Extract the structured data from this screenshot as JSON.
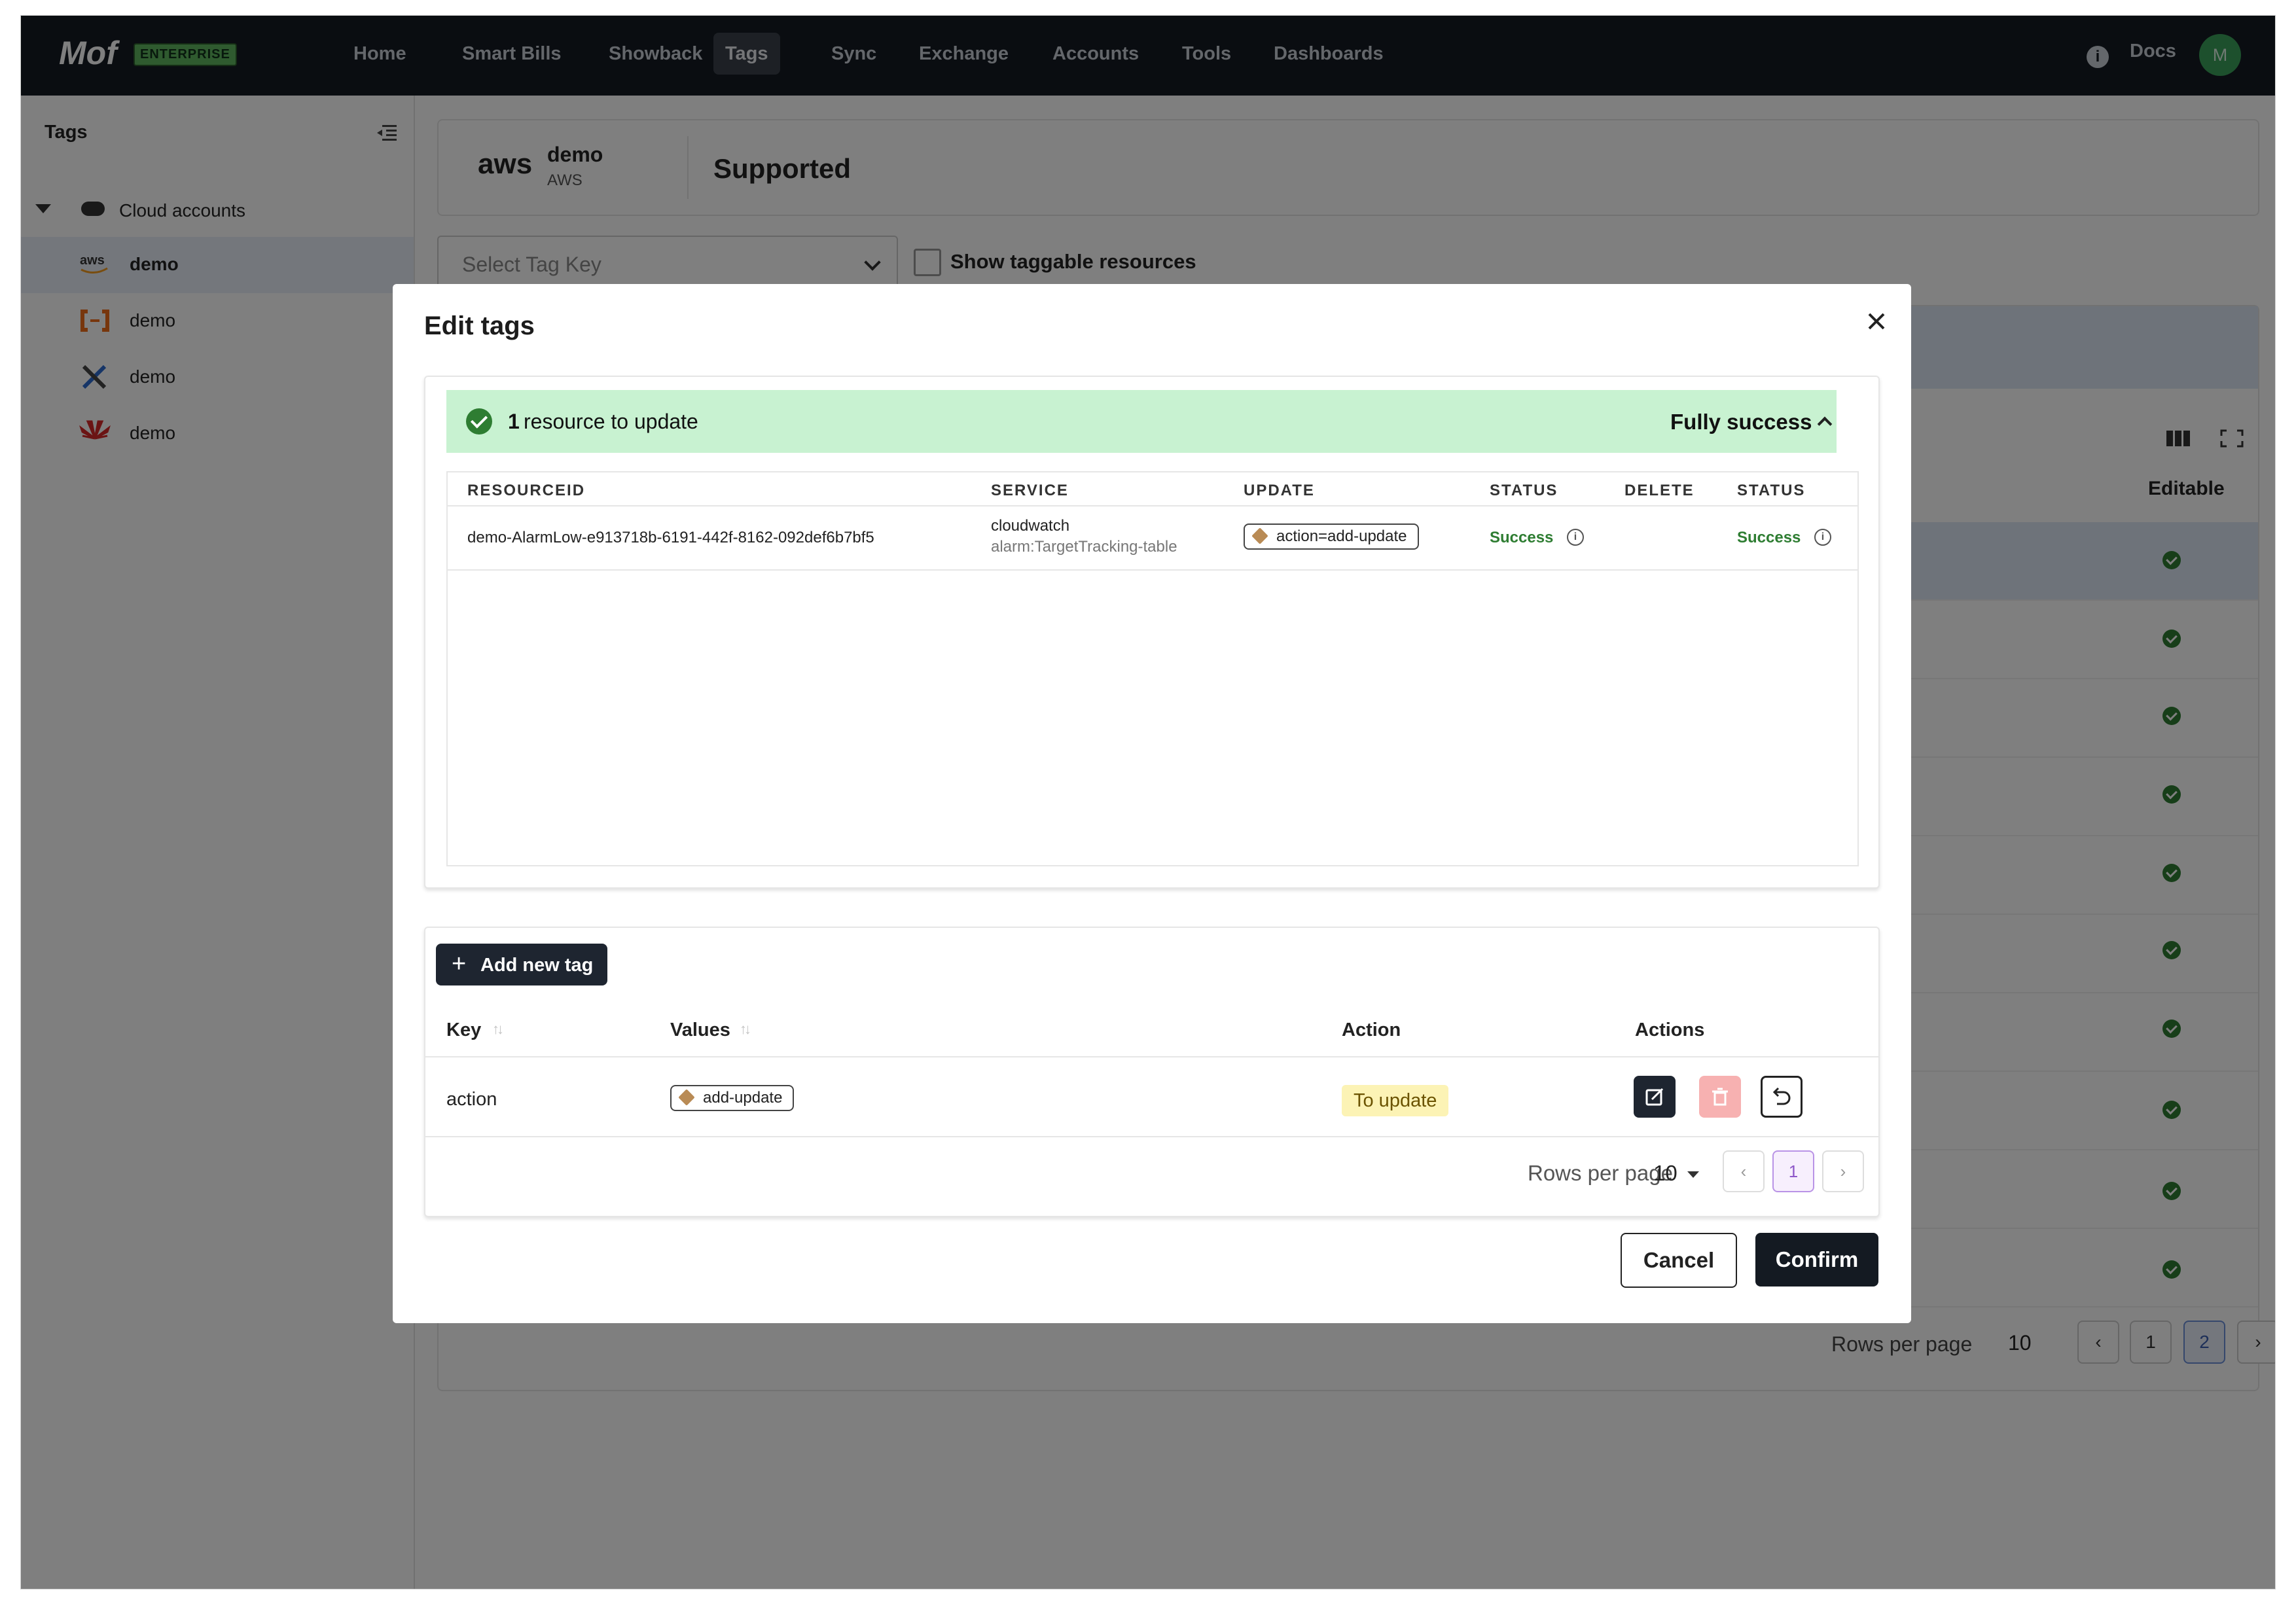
{
  "brand": {
    "logo": "Mof",
    "edition": "ENTERPRISE"
  },
  "nav": {
    "items": [
      "Home",
      "Smart Bills",
      "Showback",
      "Tags",
      "Sync",
      "Exchange",
      "Accounts",
      "Tools",
      "Dashboards"
    ],
    "active": "Tags",
    "docs": "Docs",
    "avatar": "M"
  },
  "sidebar": {
    "title": "Tags",
    "group": "Cloud accounts",
    "accounts": [
      {
        "name": "demo",
        "provider_icon": "aws-icon",
        "selected": true
      },
      {
        "name": "demo",
        "provider_icon": "alibaba-icon",
        "selected": false
      },
      {
        "name": "demo",
        "provider_icon": "tools-icon",
        "selected": false
      },
      {
        "name": "demo",
        "provider_icon": "huawei-icon",
        "selected": false
      }
    ]
  },
  "account_card": {
    "logo": "aws",
    "name": "demo",
    "provider": "AWS",
    "status": "Supported"
  },
  "filters": {
    "tag_key_placeholder": "Select Tag Key",
    "show_taggable": "Show taggable resources"
  },
  "background_table": {
    "editable_header": "Editable",
    "rows_per_page_label": "Rows per page",
    "rows_per_page": "10",
    "pages": [
      "1",
      "2"
    ],
    "current_page": "2"
  },
  "modal": {
    "title": "Edit tags",
    "summary": {
      "count": "1",
      "text": "resource to update",
      "result": "Fully success"
    },
    "resource_table": {
      "headers": [
        "RESOURCEID",
        "SERVICE",
        "UPDATE",
        "STATUS",
        "DELETE",
        "STATUS"
      ],
      "rows": [
        {
          "resource_id": "demo-AlarmLow-e913718b-6191-442f-8162-092def6b7bf5",
          "service": "cloudwatch",
          "service_sub": "alarm:TargetTracking-table",
          "update": "action=add-update",
          "update_status": "Success",
          "delete": "",
          "delete_status": "Success"
        }
      ]
    },
    "add_tag_label": "Add new tag",
    "tag_table": {
      "headers": {
        "key": "Key",
        "values": "Values",
        "action": "Action",
        "actions": "Actions"
      },
      "rows": [
        {
          "key": "action",
          "value": "add-update",
          "action": "To update"
        }
      ]
    },
    "pager": {
      "rows_per_page_label": "Rows per page",
      "rows_per_page": "10",
      "current_page": "1"
    },
    "cancel": "Cancel",
    "confirm": "Confirm"
  },
  "colors": {
    "topbar": "#151a22",
    "success": "#2e7d32",
    "banner": "#c8f2d1",
    "badge_to_update": "#fcf3b5"
  }
}
